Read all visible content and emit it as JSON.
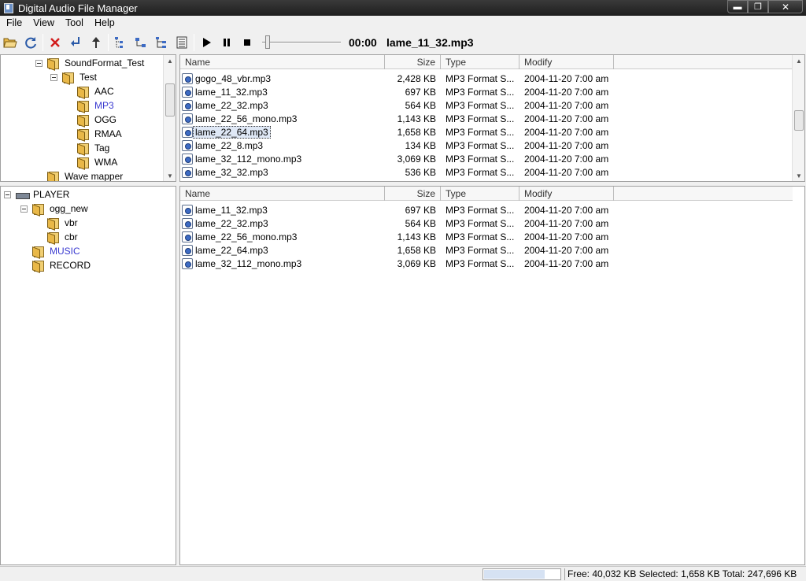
{
  "window": {
    "title": "Digital Audio File Manager",
    "min": "▬",
    "max": "❐",
    "close": "✕"
  },
  "menu": [
    "File",
    "View",
    "Tool",
    "Help"
  ],
  "toolbar": {
    "time": "00:00",
    "track": "lame_11_32.mp3",
    "seek_position": 0.0
  },
  "top_tree": {
    "items": [
      {
        "label": "SoundFormat_Test",
        "level": 0,
        "expand": true
      },
      {
        "label": "Test",
        "level": 1,
        "expand": true
      },
      {
        "label": "AAC",
        "level": 2
      },
      {
        "label": "MP3",
        "level": 2,
        "selected": true
      },
      {
        "label": "OGG",
        "level": 2
      },
      {
        "label": "RMAA",
        "level": 2
      },
      {
        "label": "Tag",
        "level": 2
      },
      {
        "label": "WMA",
        "level": 2
      },
      {
        "label": "Wave mapper",
        "level": 0
      }
    ]
  },
  "bottom_tree": {
    "root": "PLAYER",
    "items": [
      {
        "label": "ogg_new",
        "level": 1,
        "expand": true
      },
      {
        "label": "vbr",
        "level": 2
      },
      {
        "label": "cbr",
        "level": 2
      },
      {
        "label": "MUSIC",
        "level": 1,
        "selected": true
      },
      {
        "label": "RECORD",
        "level": 1
      }
    ]
  },
  "columns": {
    "name": "Name",
    "size": "Size",
    "type": "Type",
    "modify": "Modify"
  },
  "top_files": [
    {
      "name": "gogo_48_vbr.mp3",
      "size": "2,428 KB",
      "type": "MP3 Format S...",
      "modify": "2004-11-20 7:00 am"
    },
    {
      "name": "lame_11_32.mp3",
      "size": "697 KB",
      "type": "MP3 Format S...",
      "modify": "2004-11-20 7:00 am"
    },
    {
      "name": "lame_22_32.mp3",
      "size": "564 KB",
      "type": "MP3 Format S...",
      "modify": "2004-11-20 7:00 am"
    },
    {
      "name": "lame_22_56_mono.mp3",
      "size": "1,143 KB",
      "type": "MP3 Format S...",
      "modify": "2004-11-20 7:00 am"
    },
    {
      "name": "lame_22_64.mp3",
      "size": "1,658 KB",
      "type": "MP3 Format S...",
      "modify": "2004-11-20 7:00 am",
      "selected": true
    },
    {
      "name": "lame_22_8.mp3",
      "size": "134 KB",
      "type": "MP3 Format S...",
      "modify": "2004-11-20 7:00 am"
    },
    {
      "name": "lame_32_112_mono.mp3",
      "size": "3,069 KB",
      "type": "MP3 Format S...",
      "modify": "2004-11-20 7:00 am"
    },
    {
      "name": "lame_32_32.mp3",
      "size": "536 KB",
      "type": "MP3 Format S...",
      "modify": "2004-11-20 7:00 am"
    }
  ],
  "bottom_files": [
    {
      "name": "lame_11_32.mp3",
      "size": "697 KB",
      "type": "MP3 Format S...",
      "modify": "2004-11-20 7:00 am"
    },
    {
      "name": "lame_22_32.mp3",
      "size": "564 KB",
      "type": "MP3 Format S...",
      "modify": "2004-11-20 7:00 am"
    },
    {
      "name": "lame_22_56_mono.mp3",
      "size": "1,143 KB",
      "type": "MP3 Format S...",
      "modify": "2004-11-20 7:00 am"
    },
    {
      "name": "lame_22_64.mp3",
      "size": "1,658 KB",
      "type": "MP3 Format S...",
      "modify": "2004-11-20 7:00 am"
    },
    {
      "name": "lame_32_112_mono.mp3",
      "size": "3,069 KB",
      "type": "MP3 Format S...",
      "modify": "2004-11-20 7:00 am"
    }
  ],
  "status": {
    "text": "Free:  40,032 KB   Selected:   1,658 KB   Total:  247,696 KB",
    "progress": 0.8
  },
  "colors": {
    "titlebar": "#1e1e1e",
    "selected_tree": "#3a3ad0",
    "folder": "#f1cf73"
  }
}
